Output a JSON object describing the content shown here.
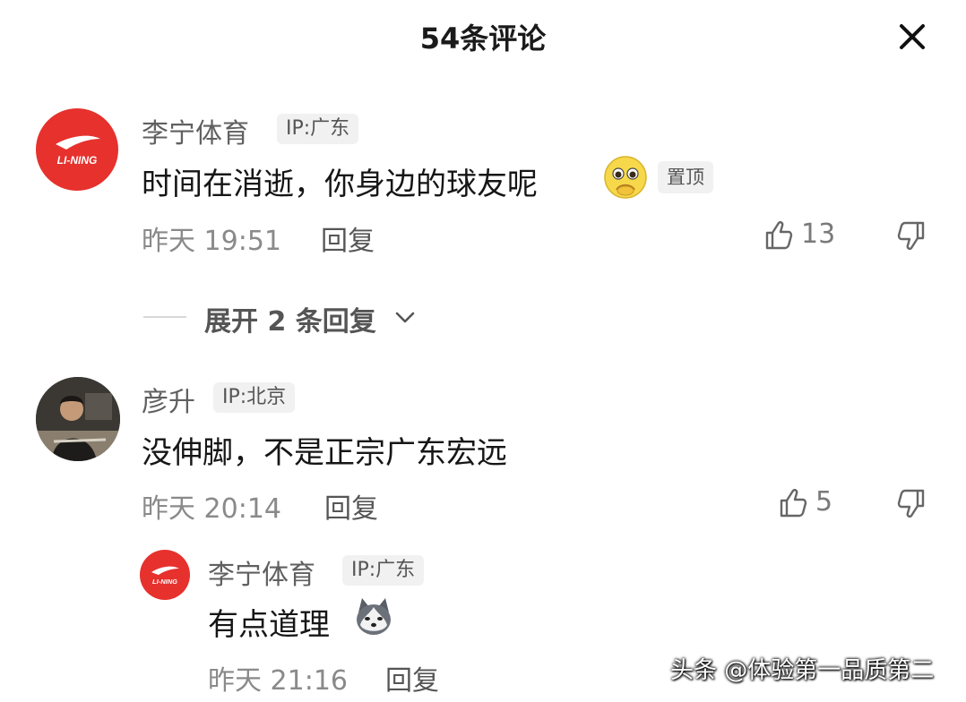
{
  "header": {
    "title": "54条评论"
  },
  "comments": [
    {
      "name": "李宁体育",
      "ip": "IP:广东",
      "content": "时间在消逝，你身边的球友呢",
      "pin_label": "置顶",
      "time": "昨天 19:51",
      "reply_label": "回复",
      "likes": "13",
      "avatar_text": "LI-NING"
    },
    {
      "name": "彦升",
      "ip": "IP:北京",
      "content": "没伸脚，不是正宗广东宏远",
      "time": "昨天 20:14",
      "reply_label": "回复",
      "likes": "5"
    }
  ],
  "expand": {
    "label": "展开 2 条回复"
  },
  "reply": {
    "name": "李宁体育",
    "ip": "IP:广东",
    "content": "有点道理",
    "time": "昨天 21:16",
    "reply_label": "回复",
    "avatar_text": "LI-NING"
  },
  "watermark": "头条 @体验第一品质第二",
  "colors": {
    "brand_red": "#e6312d",
    "text": "#161616",
    "muted": "#8a8a8a"
  }
}
